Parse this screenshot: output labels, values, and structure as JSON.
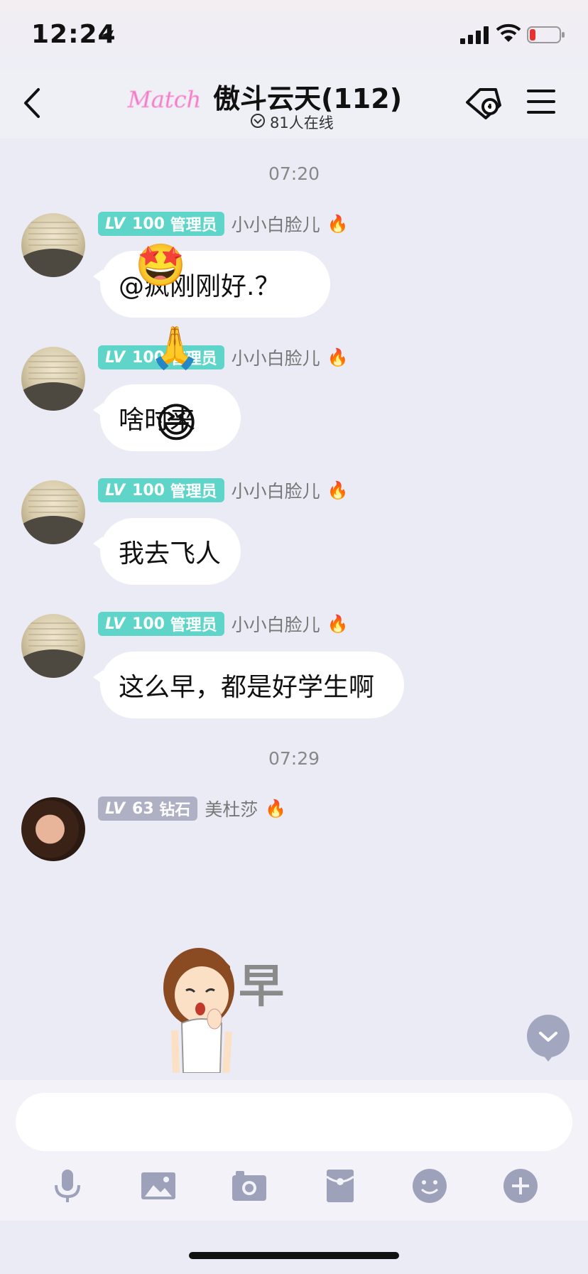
{
  "status": {
    "time": "12:24"
  },
  "header": {
    "logo_text": "Match",
    "title": "傲斗云天(112)",
    "online_text": "81人在线"
  },
  "timestamps": [
    "07:20",
    "07:29"
  ],
  "messages": [
    {
      "level": "LV",
      "level_num": "100",
      "role": "管理员",
      "user": "小小白脸儿",
      "text": "@疯刚刚好.？"
    },
    {
      "level": "LV",
      "level_num": "100",
      "role": "管理员",
      "user": "小小白脸儿",
      "text": "啥时来"
    },
    {
      "level": "LV",
      "level_num": "100",
      "role": "管理员",
      "user": "小小白脸儿",
      "text": "我去飞人"
    },
    {
      "level": "LV",
      "level_num": "100",
      "role": "管理员",
      "user": "小小白脸儿",
      "text": "这么早，都是好学生啊"
    },
    {
      "level": "LV",
      "level_num": "63",
      "role": "钻石",
      "user": "美杜莎",
      "sticker_text": "早"
    }
  ],
  "input": {
    "placeholder": ""
  },
  "toolbar": [
    "mic-icon",
    "image-icon",
    "camera-icon",
    "redpacket-icon",
    "emoji-icon",
    "plus-icon"
  ],
  "colors": {
    "admin_badge": "#5ed5c8",
    "diamond_badge": "#aeb0c4",
    "background": "#ebebf5"
  }
}
